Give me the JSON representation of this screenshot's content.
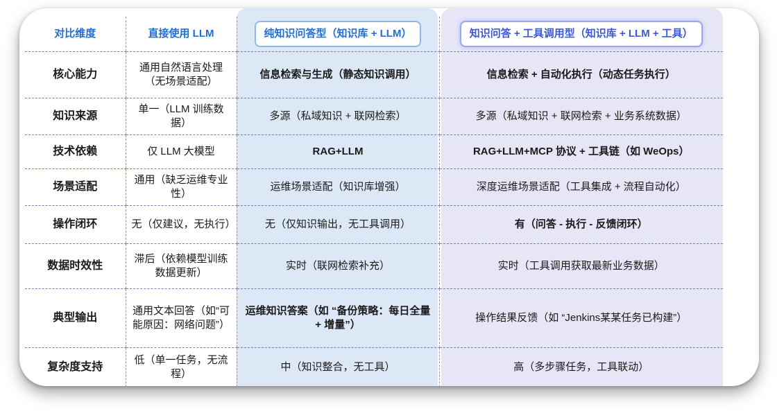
{
  "headers": {
    "dimension": "对比维度",
    "direct_llm": "直接使用 LLM",
    "pure_kb": "纯知识问答型（知识库 + LLM）",
    "kb_tools": "知识问答 + 工具调用型（知识库 + LLM + 工具）"
  },
  "rows": [
    {
      "dimension": "核心能力",
      "direct_llm": "通用自然语言处理（无场景适配）",
      "pure_kb": "信息检索与生成（静态知识调用）",
      "kb_tools": "信息检索 + 自动化执行（动态任务执行）"
    },
    {
      "dimension": "知识来源",
      "direct_llm": "单一（LLM 训练数据）",
      "pure_kb": "多源（私域知识 + 联网检索）",
      "kb_tools": "多源（私域知识 + 联网检索 + 业务系统数据）"
    },
    {
      "dimension": "技术依赖",
      "direct_llm": "仅 LLM 大模型",
      "pure_kb": "RAG+LLM",
      "kb_tools": "RAG+LLM+MCP 协议 + 工具链（如 WeOps）"
    },
    {
      "dimension": "场景适配",
      "direct_llm": "通用（缺乏运维专业性）",
      "pure_kb": "运维场景适配（知识库增强）",
      "kb_tools": "深度运维场景适配（工具集成 + 流程自动化）"
    },
    {
      "dimension": "操作闭环",
      "direct_llm": "无（仅建议，无执行）",
      "pure_kb": "无（仅知识输出，无工具调用）",
      "kb_tools": "有（问答 - 执行 - 反馈闭环）"
    },
    {
      "dimension": "数据时效性",
      "direct_llm": "滞后（依赖模型训练数据更新）",
      "pure_kb": "实时（联网检索补充）",
      "kb_tools": "实时（工具调用获取最新业务数据）"
    },
    {
      "dimension": "典型输出",
      "direct_llm": "通用文本回答（如“可能原因：网络问题”）",
      "pure_kb": "运维知识答案（如 “备份策略：每日全量 + 增量”）",
      "kb_tools": "操作结果反馈（如 “Jenkins某某任务已构建”）"
    },
    {
      "dimension": "复杂度支持",
      "direct_llm": "低（单一任务，无流程）",
      "pure_kb": "中（知识整合，无工具）",
      "kb_tools": "高（多步骤任务，工具联动）"
    }
  ]
}
